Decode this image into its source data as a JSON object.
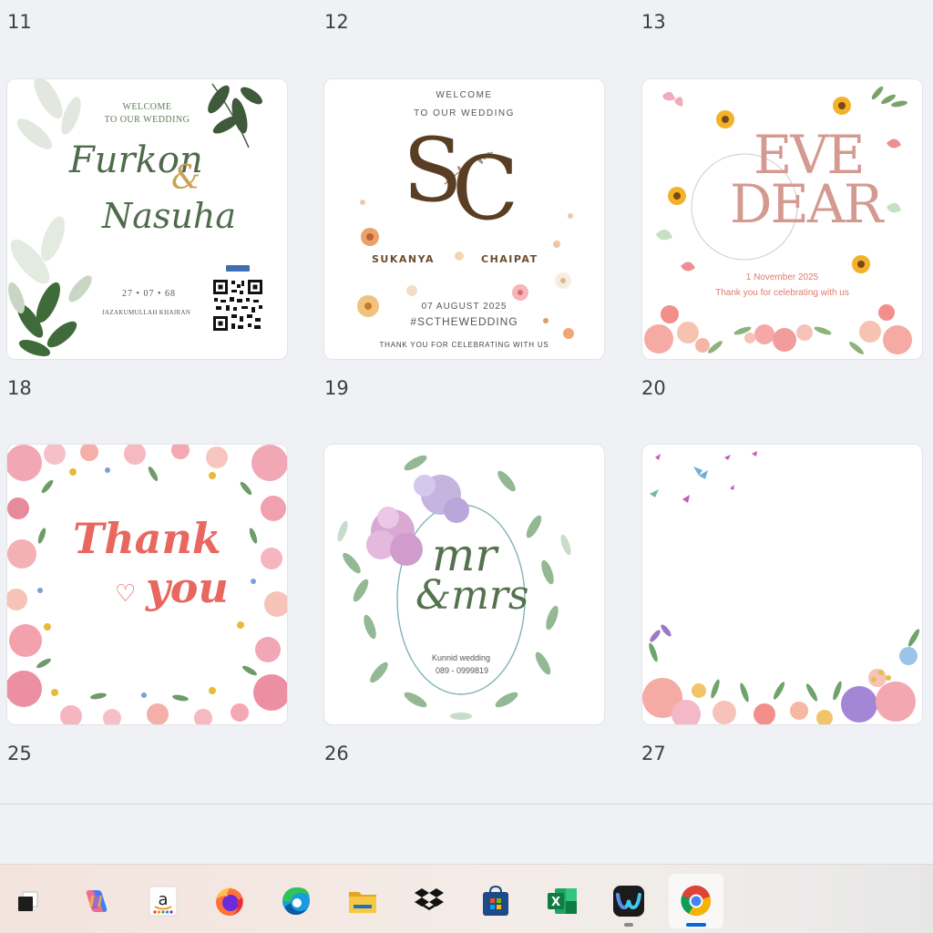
{
  "row1_numbers": [
    "11",
    "12",
    "13"
  ],
  "row2_numbers": [
    "18",
    "19",
    "20"
  ],
  "row3_numbers": [
    "25",
    "26",
    "27"
  ],
  "card18": {
    "welcome": "WELCOME",
    "to_wedding": "TO OUR WEDDING",
    "name1": "Furkon",
    "amp": "&",
    "name2": "Nasuha",
    "date": "27 • 07 • 68",
    "footer": "JAZAKUMULLAH KHAIRAN"
  },
  "card19": {
    "welcome": "WELCOME",
    "to_wedding": "TO OUR WEDDING",
    "monogram_s": "S",
    "monogram_c": "C",
    "name1": "SUKANYA",
    "name2": "CHAIPAT",
    "date": "07 AUGUST 2025",
    "hashtag": "#SCTHEWEDDING",
    "thanks": "THANK YOU FOR CELEBRATING WITH US"
  },
  "card20": {
    "title1": "EVE",
    "title2": "DEAR",
    "date": "1 November 2025",
    "thanks": "Thank you for celebrating with us"
  },
  "card25": {
    "line1": "Thank",
    "line2": "you"
  },
  "card26": {
    "line1": "mr",
    "line2": "&mrs",
    "subtitle": "Kunnid wedding",
    "phone": "089 - 0999819"
  },
  "taskbar": {
    "apps": [
      "Task View",
      "Copilot",
      "Amazon",
      "Firefox",
      "Microsoft Edge",
      "File Explorer",
      "Dropbox",
      "Microsoft Store",
      "Excel",
      "Webex",
      "Google Chrome"
    ],
    "excel_letter": "X",
    "amazon_letter": "a"
  },
  "colors": {
    "green": "#4f6b4c",
    "gold": "#c8a255",
    "brown": "#5a3e24",
    "rose": "#d49a92",
    "coral": "#e8675e",
    "chrome_blue": "#0a66d8"
  }
}
